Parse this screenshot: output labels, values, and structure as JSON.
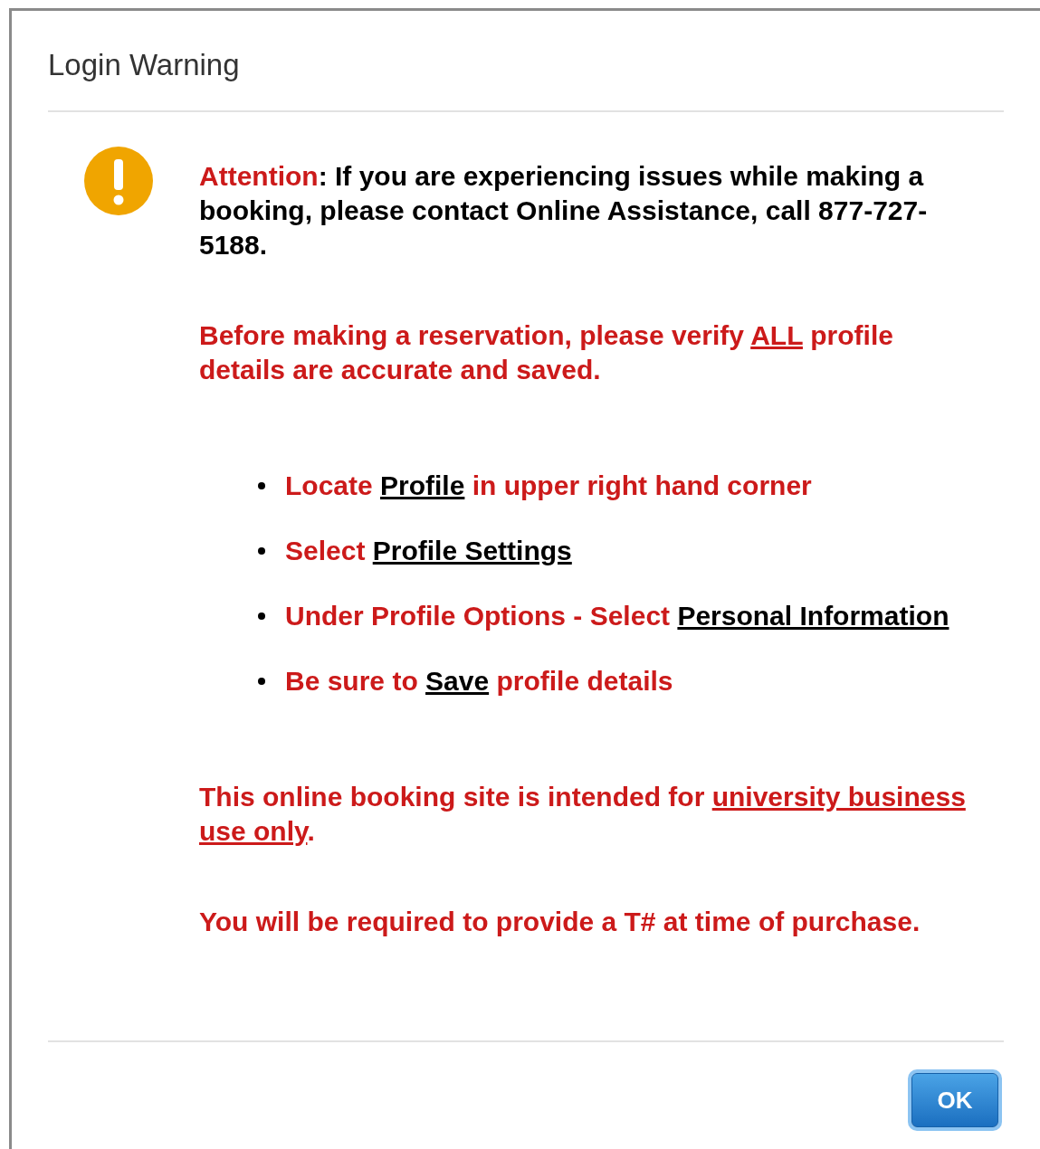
{
  "dialog": {
    "title": "Login Warning",
    "body": [
      {
        "kind": "paragraph",
        "segments": [
          {
            "kind": "alert",
            "text": "Attention"
          },
          {
            "kind": "text",
            "text": ": If you are experiencing issues while making a booking, please contact Online Assistance, call 877-727-5188."
          }
        ]
      },
      {
        "kind": "paragraph",
        "segments": [
          {
            "kind": "alert",
            "text": "Before making a reservation, please verify "
          },
          {
            "kind": "emphasis",
            "text": "ALL"
          },
          {
            "kind": "alert",
            "text": " profile details are accurate and saved."
          }
        ]
      },
      {
        "kind": "list",
        "items": [
          {
            "segments": [
              {
                "kind": "alert",
                "text": "Locate "
              },
              {
                "kind": "link",
                "text": "Profile"
              },
              {
                "kind": "alert",
                "text": " in upper right hand corner"
              }
            ]
          },
          {
            "segments": [
              {
                "kind": "alert",
                "text": "Select "
              },
              {
                "kind": "link",
                "text": "Profile Settings"
              }
            ]
          },
          {
            "segments": [
              {
                "kind": "alert",
                "text": "Under Profile Options - Select "
              },
              {
                "kind": "link",
                "text": "Personal Information"
              }
            ]
          },
          {
            "segments": [
              {
                "kind": "alert",
                "text": "Be sure to "
              },
              {
                "kind": "link",
                "text": "Save"
              },
              {
                "kind": "alert",
                "text": " profile details"
              }
            ]
          }
        ]
      },
      {
        "kind": "paragraph",
        "segments": [
          {
            "kind": "alert",
            "text": "This online booking site is intended for "
          },
          {
            "kind": "emphasis",
            "text": "university business use only"
          },
          {
            "kind": "alert",
            "text": "."
          }
        ]
      },
      {
        "kind": "paragraph",
        "segments": [
          {
            "kind": "alert",
            "text": "You will be required to provide a T# at time of purchase."
          }
        ]
      }
    ],
    "buttons": [
      {
        "label": "OK",
        "focused": true
      }
    ]
  }
}
